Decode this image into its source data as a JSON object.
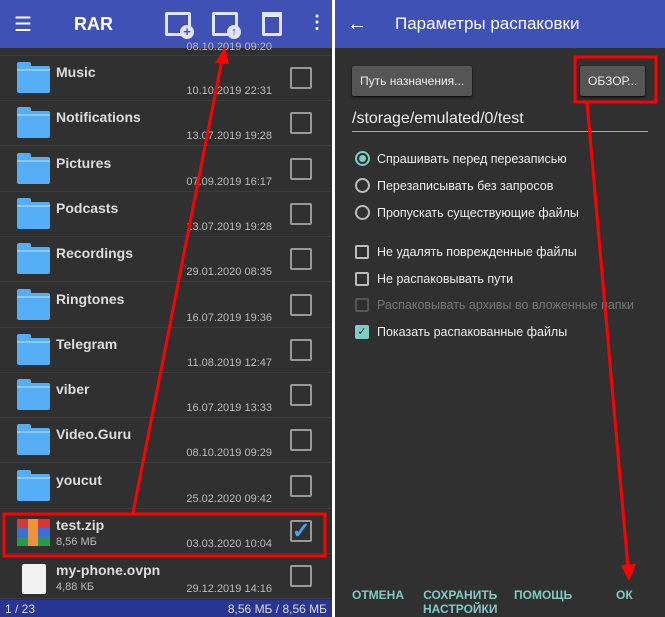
{
  "left": {
    "title": "RAR",
    "icons": [
      "menu-icon",
      "archive-add-icon",
      "archive-extract-icon",
      "delete-icon",
      "more-icon"
    ],
    "partial_row_date": "08.10.2019 09:20",
    "rows": [
      {
        "name": "Music",
        "date": "10.10.2019 22:31",
        "type": "folder",
        "checked": false
      },
      {
        "name": "Notifications",
        "date": "13.07.2019 19:28",
        "type": "folder",
        "checked": false
      },
      {
        "name": "Pictures",
        "date": "07.09.2019 16:17",
        "type": "folder",
        "checked": false
      },
      {
        "name": "Podcasts",
        "date": "13.07.2019 19:28",
        "type": "folder",
        "checked": false
      },
      {
        "name": "Recordings",
        "date": "29.01.2020 08:35",
        "type": "folder",
        "checked": false
      },
      {
        "name": "Ringtones",
        "date": "16.07.2019 19:36",
        "type": "folder",
        "checked": false
      },
      {
        "name": "Telegram",
        "date": "11.08.2019 12:47",
        "type": "folder",
        "checked": false
      },
      {
        "name": "viber",
        "date": "16.07.2019 13:33",
        "type": "folder",
        "checked": false
      },
      {
        "name": "Video.Guru",
        "date": "08.10.2019 09:29",
        "type": "folder",
        "checked": false
      },
      {
        "name": "youcut",
        "date": "25.02.2020 09:42",
        "type": "folder",
        "checked": false
      },
      {
        "name": "test.zip",
        "size": "8,56 МБ",
        "date": "03.03.2020 10:04",
        "type": "archive",
        "checked": true
      },
      {
        "name": "my-phone.ovpn",
        "size": "4,88 КБ",
        "date": "29.12.2019 14:16",
        "type": "file",
        "checked": false
      }
    ],
    "status_count": "1 / 23",
    "status_size": "8,56 МБ / 8,56 МБ"
  },
  "right": {
    "title": "Параметры распаковки",
    "dest_button": "Путь назначения...",
    "browse_button": "ОБЗОР...",
    "path": "/storage/emulated/0/test",
    "radios": [
      {
        "label": "Спрашивать перед перезаписью",
        "selected": true
      },
      {
        "label": "Перезаписывать без запросов",
        "selected": false
      },
      {
        "label": "Пропускать существующие файлы",
        "selected": false
      }
    ],
    "checks": [
      {
        "label": "Не удалять поврежденные файлы",
        "checked": false,
        "disabled": false
      },
      {
        "label": "Не распаковывать пути",
        "checked": false,
        "disabled": false
      },
      {
        "label": "Распаковывать архивы во вложенные папки",
        "checked": false,
        "disabled": true
      },
      {
        "label": "Показать распакованные файлы",
        "checked": true,
        "disabled": false
      }
    ],
    "actions": {
      "cancel": "ОТМЕНА",
      "save1": "СОХРАНИТЬ",
      "save2": "НАСТРОЙКИ",
      "help": "ПОМОЩЬ",
      "ok": "ОК"
    }
  },
  "colors": {
    "appbar": "#3f51b5",
    "accent": "#80cbc4",
    "annotation": "#ff0000"
  }
}
